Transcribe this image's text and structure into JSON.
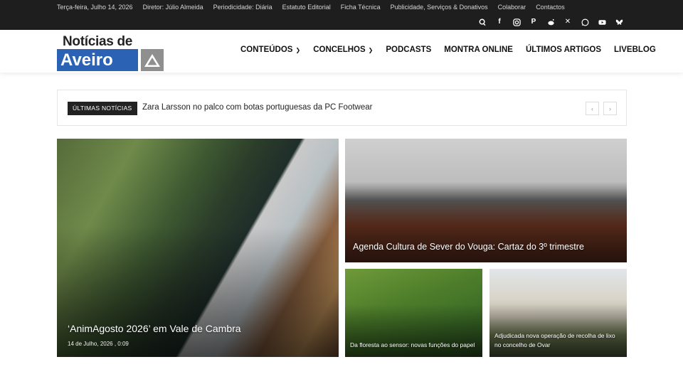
{
  "topbar": {
    "links": [
      "Terça-feira, Julho 14, 2026",
      "Diretor: Júlio Almeida",
      "Periodicidade: Diária",
      "Estatuto Editorial",
      "Ficha Técnica",
      "Publicidade, Serviços & Donativos",
      "Colaborar",
      "Contactos"
    ],
    "icons": [
      "search-icon",
      "facebook-icon",
      "instagram-icon",
      "paypal-icon",
      "reddit-icon",
      "x-icon",
      "whatsapp-icon",
      "youtube-icon",
      "bluesky-icon"
    ]
  },
  "logo": {
    "line1": "Notícias de",
    "line2": "Aveiro",
    "brand_color": "#2b62b3"
  },
  "nav": {
    "items": [
      "CONTEÚDOS",
      "CONCELHOS",
      "PODCASTS",
      "MONTRA ONLINE",
      "ÚLTIMOS ARTIGOS",
      "LIVEBLOG"
    ]
  },
  "ticker": {
    "tag": "ÚLTIMAS NOTÍCIAS",
    "headline": "Zara Larsson no palco com botas portuguesas da PC Footwear",
    "prev": "‹",
    "next": "›"
  },
  "articles": [
    {
      "title": "‘AnimAgosto 2026’ em Vale de Cambra",
      "date": "14 de Julho, 2026 , 0:09"
    },
    {
      "title": "Agenda Cultura de Sever do Vouga: Cartaz do 3º trimestre"
    },
    {
      "title": "Da floresta ao sensor: novas funções do papel"
    },
    {
      "title": "Adjudicada nova operação de recolha de lixo no concelho de Ovar"
    }
  ]
}
